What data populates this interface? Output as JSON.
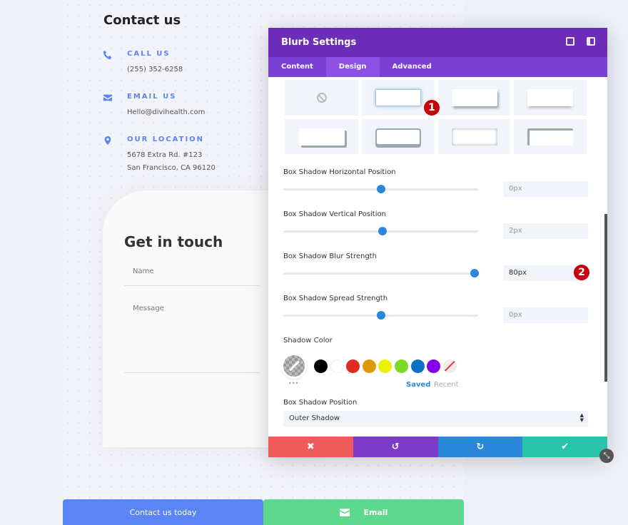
{
  "contact": {
    "title": "Contact us",
    "items": [
      {
        "icon": "phone-icon",
        "title": "CALL US",
        "lines": [
          "(255) 352-6258"
        ]
      },
      {
        "icon": "envelope-icon",
        "title": "EMAIL US",
        "lines": [
          "Hello@divihealth.com"
        ]
      },
      {
        "icon": "map-pin-icon",
        "title": "OUR LOCATION",
        "lines": [
          "5678 Extra Rd. #123",
          "San Francisco, CA 96120"
        ]
      }
    ]
  },
  "form": {
    "title": "Get in touch",
    "name_placeholder": "Name",
    "message_placeholder": "Message"
  },
  "bottom": {
    "contact_button": "Contact us today",
    "email_button": "Email"
  },
  "modal": {
    "title": "Blurb Settings",
    "tabs": [
      "Content",
      "Design",
      "Advanced"
    ],
    "active_tab": "Design",
    "settings": [
      {
        "label": "Box Shadow Horizontal Position",
        "value": "0px",
        "slider_percent": 50
      },
      {
        "label": "Box Shadow Vertical Position",
        "value": "2px",
        "slider_percent": 51
      },
      {
        "label": "Box Shadow Blur Strength",
        "value": "80px",
        "slider_percent": 98
      },
      {
        "label": "Box Shadow Spread Strength",
        "value": "0px",
        "slider_percent": 50
      }
    ],
    "shadow_color_label": "Shadow Color",
    "swatches": [
      "#000000",
      "#ffffff",
      "#e02b20",
      "#e09900",
      "#edf000",
      "#7cda24",
      "#0c71c3",
      "#8300e9"
    ],
    "palette_tabs": {
      "saved": "Saved",
      "recent": "Recent"
    },
    "more": "•••",
    "position_label": "Box Shadow Position",
    "position_value": "Outer Shadow",
    "badges": [
      "1",
      "2"
    ],
    "colors": {
      "header": "#6c2eb9",
      "tabs": "#7b3fd4",
      "cancel": "#ef5a5a",
      "undo": "#7d3bca",
      "redo": "#2b87da",
      "save": "#29c4a9"
    }
  }
}
